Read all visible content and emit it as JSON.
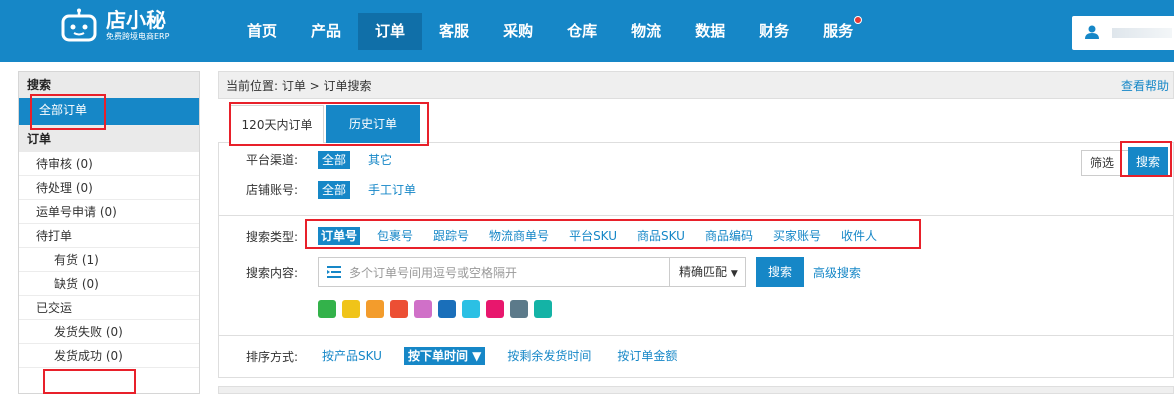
{
  "brand": {
    "name": "店小秘",
    "tagline": "免费跨境电商ERP"
  },
  "nav": {
    "items": [
      {
        "label": "首页",
        "active": false
      },
      {
        "label": "产品",
        "active": false
      },
      {
        "label": "订单",
        "active": true
      },
      {
        "label": "客服",
        "active": false
      },
      {
        "label": "采购",
        "active": false
      },
      {
        "label": "仓库",
        "active": false
      },
      {
        "label": "物流",
        "active": false
      },
      {
        "label": "数据",
        "active": false
      },
      {
        "label": "财务",
        "active": false
      },
      {
        "label": "服务",
        "active": false,
        "notification_dot": true
      }
    ]
  },
  "sidebar": {
    "search_header": "搜索",
    "all_orders": "全部订单",
    "orders_header": "订单",
    "items": [
      {
        "label": "待审核 (0)",
        "level": 1
      },
      {
        "label": "待处理 (0)",
        "level": 1
      },
      {
        "label": "运单号申请 (0)",
        "level": 1
      },
      {
        "label": "待打单",
        "level": 1
      },
      {
        "label": "有货 (1)",
        "level": 2
      },
      {
        "label": "缺货 (0)",
        "level": 2
      },
      {
        "label": "已交运",
        "level": 1
      },
      {
        "label": "发货失败 (0)",
        "level": 2
      },
      {
        "label": "发货成功 (0)",
        "level": 2
      }
    ]
  },
  "breadcrumb": {
    "text": "当前位置:  订单 > 订单搜索",
    "help": "查看帮助"
  },
  "tabs": {
    "recent": "120天内订单",
    "history": "历史订单"
  },
  "filters": {
    "platform_label": "平台渠道:",
    "platform_options": [
      "全部",
      "其它"
    ],
    "shop_label": "店铺账号:",
    "shop_options": [
      "全部",
      "手工订单"
    ],
    "filter_button": "筛选",
    "search_button": "搜索"
  },
  "search": {
    "type_label": "搜索类型:",
    "types": [
      "订单号",
      "包裹号",
      "跟踪号",
      "物流商单号",
      "平台SKU",
      "商品SKU",
      "商品编码",
      "买家账号",
      "收件人"
    ],
    "content_label": "搜索内容:",
    "placeholder": "多个订单号间用逗号或空格隔开",
    "match_mode": "精确匹配",
    "search_button": "搜索",
    "advanced": "高级搜索",
    "colors": [
      "#33b24a",
      "#f0c419",
      "#f39c2c",
      "#ec4f34",
      "#d070c8",
      "#1a6fba",
      "#2bc0e4",
      "#e8176d",
      "#5c7a8a",
      "#14b3a6"
    ]
  },
  "sort": {
    "label": "排序方式:",
    "options": [
      "按产品SKU",
      "按下单时间",
      "按剩余发货时间",
      "按订单金额"
    ],
    "active_arrow": "▼"
  },
  "icons": {
    "user": "user-icon",
    "list": "list-icon",
    "dropdown": "caret-down-icon"
  }
}
